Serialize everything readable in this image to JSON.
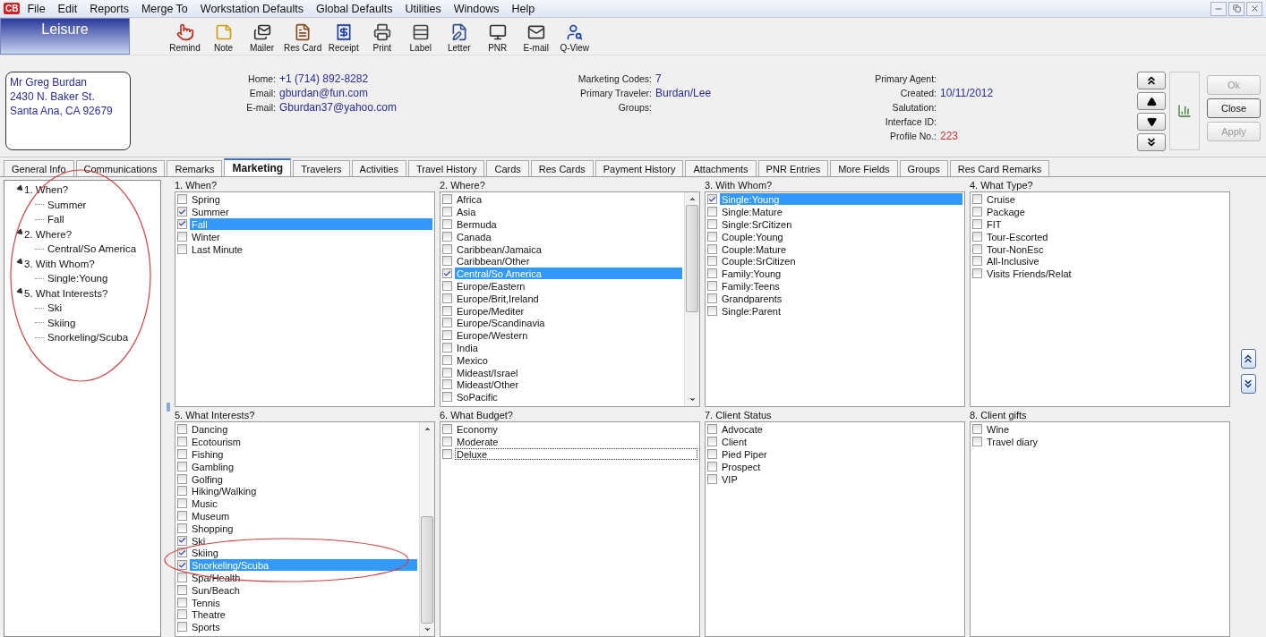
{
  "menu": {
    "logo": "CB",
    "items": [
      "File",
      "Edit",
      "Reports",
      "Merge To",
      "Workstation Defaults",
      "Global Defaults",
      "Utilities",
      "Windows",
      "Help"
    ]
  },
  "toolbar": {
    "title": "Leisure",
    "buttons": [
      "Remind",
      "Note",
      "Mailer",
      "Res Card",
      "Receipt",
      "Print",
      "Label",
      "Letter",
      "PNR",
      "E-mail",
      "Q-View"
    ]
  },
  "profile": {
    "address": [
      "Mr Greg Burdan",
      "2430 N. Baker St.",
      "Santa Ana, CA 92679"
    ],
    "contacts": [
      {
        "label": "Home:",
        "value": "+1 (714) 892-8282"
      },
      {
        "label": "Email:",
        "value": "gburdan@fun.com"
      },
      {
        "label": "E-mail:",
        "value": "Gburdan37@yahoo.com"
      }
    ],
    "summary": [
      {
        "label": "Marketing Codes:",
        "value": "7"
      },
      {
        "label": "Primary Traveler:",
        "value": "Burdan/Lee"
      },
      {
        "label": "Groups:"
      }
    ],
    "details": [
      {
        "label": "Primary Agent:"
      },
      {
        "label": "Created:",
        "value": "10/11/2012",
        "color": "#2a2aa0"
      },
      {
        "label": "Salutation:"
      },
      {
        "label": "Interface ID:"
      },
      {
        "label": "Profile No.:",
        "value": "223",
        "color": "#d03030"
      }
    ]
  },
  "actions": [
    {
      "label": "Ok",
      "disabled": true
    },
    {
      "label": "Close",
      "disabled": false
    },
    {
      "label": "Apply",
      "disabled": true
    }
  ],
  "tabs": [
    {
      "label": "General Info",
      "selected": false
    },
    {
      "label": "Communications",
      "selected": false
    },
    {
      "label": "Remarks",
      "selected": false
    },
    {
      "label": "Marketing",
      "selected": true
    },
    {
      "label": "Travelers",
      "selected": false
    },
    {
      "label": "Activities",
      "selected": false
    },
    {
      "label": "Travel History",
      "selected": false
    },
    {
      "label": "Cards",
      "selected": false
    },
    {
      "label": "Res Cards",
      "selected": false
    },
    {
      "label": "Payment History",
      "selected": false
    },
    {
      "label": "Attachments",
      "selected": false
    },
    {
      "label": "PNR Entries",
      "selected": false
    },
    {
      "label": "More Fields",
      "selected": false
    },
    {
      "label": "Groups",
      "selected": false
    },
    {
      "label": "Res Card Remarks",
      "selected": false
    }
  ],
  "tree": [
    {
      "label": "1. When?",
      "expanded": true,
      "children": [
        {
          "label": "Summer"
        },
        {
          "label": "Fall"
        }
      ]
    },
    {
      "label": "2. Where?",
      "expanded": true,
      "children": [
        {
          "label": "Central/So America"
        }
      ]
    },
    {
      "label": "3. With Whom?",
      "expanded": true,
      "children": [
        {
          "label": "Single:Young"
        }
      ]
    },
    {
      "label": "5. What Interests?",
      "expanded": true,
      "children": [
        {
          "label": "Ski"
        },
        {
          "label": "Skiing"
        },
        {
          "label": "Snorkeling/Scuba"
        }
      ]
    }
  ],
  "groups": [
    {
      "title": "1. When?",
      "items": [
        {
          "label": "Spring",
          "checked": false,
          "selected": false
        },
        {
          "label": "Summer",
          "checked": true,
          "selected": false
        },
        {
          "label": "Fall",
          "checked": true,
          "selected": true
        },
        {
          "label": "Winter",
          "checked": false,
          "selected": false
        },
        {
          "label": "Last Minute",
          "checked": false,
          "selected": false
        }
      ]
    },
    {
      "title": "2. Where?",
      "items": [
        {
          "label": "Africa",
          "checked": false,
          "selected": false
        },
        {
          "label": "Asia",
          "checked": false,
          "selected": false
        },
        {
          "label": "Bermuda",
          "checked": false,
          "selected": false
        },
        {
          "label": "Canada",
          "checked": false,
          "selected": false
        },
        {
          "label": "Caribbean/Jamaica",
          "checked": false,
          "selected": false
        },
        {
          "label": "Caribbean/Other",
          "checked": false,
          "selected": false
        },
        {
          "label": "Central/So America",
          "checked": true,
          "selected": true
        },
        {
          "label": "Europe/Eastern",
          "checked": false,
          "selected": false
        },
        {
          "label": "Europe/Brit,Ireland",
          "checked": false,
          "selected": false
        },
        {
          "label": "Europe/Mediter",
          "checked": false,
          "selected": false
        },
        {
          "label": "Europe/Scandinavia",
          "checked": false,
          "selected": false
        },
        {
          "label": "Europe/Western",
          "checked": false,
          "selected": false
        },
        {
          "label": "India",
          "checked": false,
          "selected": false
        },
        {
          "label": "Mexico",
          "checked": false,
          "selected": false
        },
        {
          "label": "Mideast/Israel",
          "checked": false,
          "selected": false
        },
        {
          "label": "Mideast/Other",
          "checked": false,
          "selected": false
        },
        {
          "label": "SoPacific",
          "checked": false,
          "selected": false
        }
      ]
    },
    {
      "title": "3. With Whom?",
      "items": [
        {
          "label": "Single:Young",
          "checked": true,
          "selected": true
        },
        {
          "label": "Single:Mature",
          "checked": false,
          "selected": false
        },
        {
          "label": "Single:SrCitizen",
          "checked": false,
          "selected": false
        },
        {
          "label": "Couple:Young",
          "checked": false,
          "selected": false
        },
        {
          "label": "Couple:Mature",
          "checked": false,
          "selected": false
        },
        {
          "label": "Couple:SrCitizen",
          "checked": false,
          "selected": false
        },
        {
          "label": "Family:Young",
          "checked": false,
          "selected": false
        },
        {
          "label": "Family:Teens",
          "checked": false,
          "selected": false
        },
        {
          "label": "Grandparents",
          "checked": false,
          "selected": false
        },
        {
          "label": "Single:Parent",
          "checked": false,
          "selected": false
        }
      ]
    },
    {
      "title": "4. What Type?",
      "items": [
        {
          "label": "Cruise",
          "checked": false,
          "selected": false
        },
        {
          "label": "Package",
          "checked": false,
          "selected": false
        },
        {
          "label": "FIT",
          "checked": false,
          "selected": false
        },
        {
          "label": "Tour-Escorted",
          "checked": false,
          "selected": false
        },
        {
          "label": "Tour-NonEsc",
          "checked": false,
          "selected": false
        },
        {
          "label": "All-Inclusive",
          "checked": false,
          "selected": false
        },
        {
          "label": "Visits Friends/Relat",
          "checked": false,
          "selected": false
        }
      ]
    },
    {
      "title": "5. What Interests?",
      "items": [
        {
          "label": "Dancing",
          "checked": false,
          "selected": false
        },
        {
          "label": "Ecotourism",
          "checked": false,
          "selected": false
        },
        {
          "label": "Fishing",
          "checked": false,
          "selected": false
        },
        {
          "label": "Gambling",
          "checked": false,
          "selected": false
        },
        {
          "label": "Golfing",
          "checked": false,
          "selected": false
        },
        {
          "label": "Hiking/Walking",
          "checked": false,
          "selected": false
        },
        {
          "label": "Music",
          "checked": false,
          "selected": false
        },
        {
          "label": "Museum",
          "checked": false,
          "selected": false
        },
        {
          "label": "Shopping",
          "checked": false,
          "selected": false
        },
        {
          "label": "Ski",
          "checked": true,
          "selected": false
        },
        {
          "label": "Skiing",
          "checked": true,
          "selected": false
        },
        {
          "label": "Snorkeling/Scuba",
          "checked": true,
          "selected": true
        },
        {
          "label": "Spa/Health",
          "checked": false,
          "selected": false
        },
        {
          "label": "Sun/Beach",
          "checked": false,
          "selected": false
        },
        {
          "label": "Tennis",
          "checked": false,
          "selected": false
        },
        {
          "label": "Theatre",
          "checked": false,
          "selected": false
        },
        {
          "label": "Sports",
          "checked": false,
          "selected": false
        }
      ]
    },
    {
      "title": "6. What Budget?",
      "items": [
        {
          "label": "Economy",
          "checked": false,
          "selected": false,
          "focused": false
        },
        {
          "label": "Moderate",
          "checked": false,
          "selected": false,
          "focused": false
        },
        {
          "label": "Deluxe",
          "checked": false,
          "selected": false,
          "focused": true
        }
      ]
    },
    {
      "title": "7. Client Status",
      "items": [
        {
          "label": "Advocate",
          "checked": false,
          "selected": false
        },
        {
          "label": "Client",
          "checked": false,
          "selected": false
        },
        {
          "label": "Pied Piper",
          "checked": false,
          "selected": false
        },
        {
          "label": "Prospect",
          "checked": false,
          "selected": false
        },
        {
          "label": "VIP",
          "checked": false,
          "selected": false
        }
      ]
    },
    {
      "title": "8. Client gifts",
      "items": [
        {
          "label": "Wine",
          "checked": false,
          "selected": false
        },
        {
          "label": "Travel diary",
          "checked": false,
          "selected": false
        }
      ]
    }
  ]
}
